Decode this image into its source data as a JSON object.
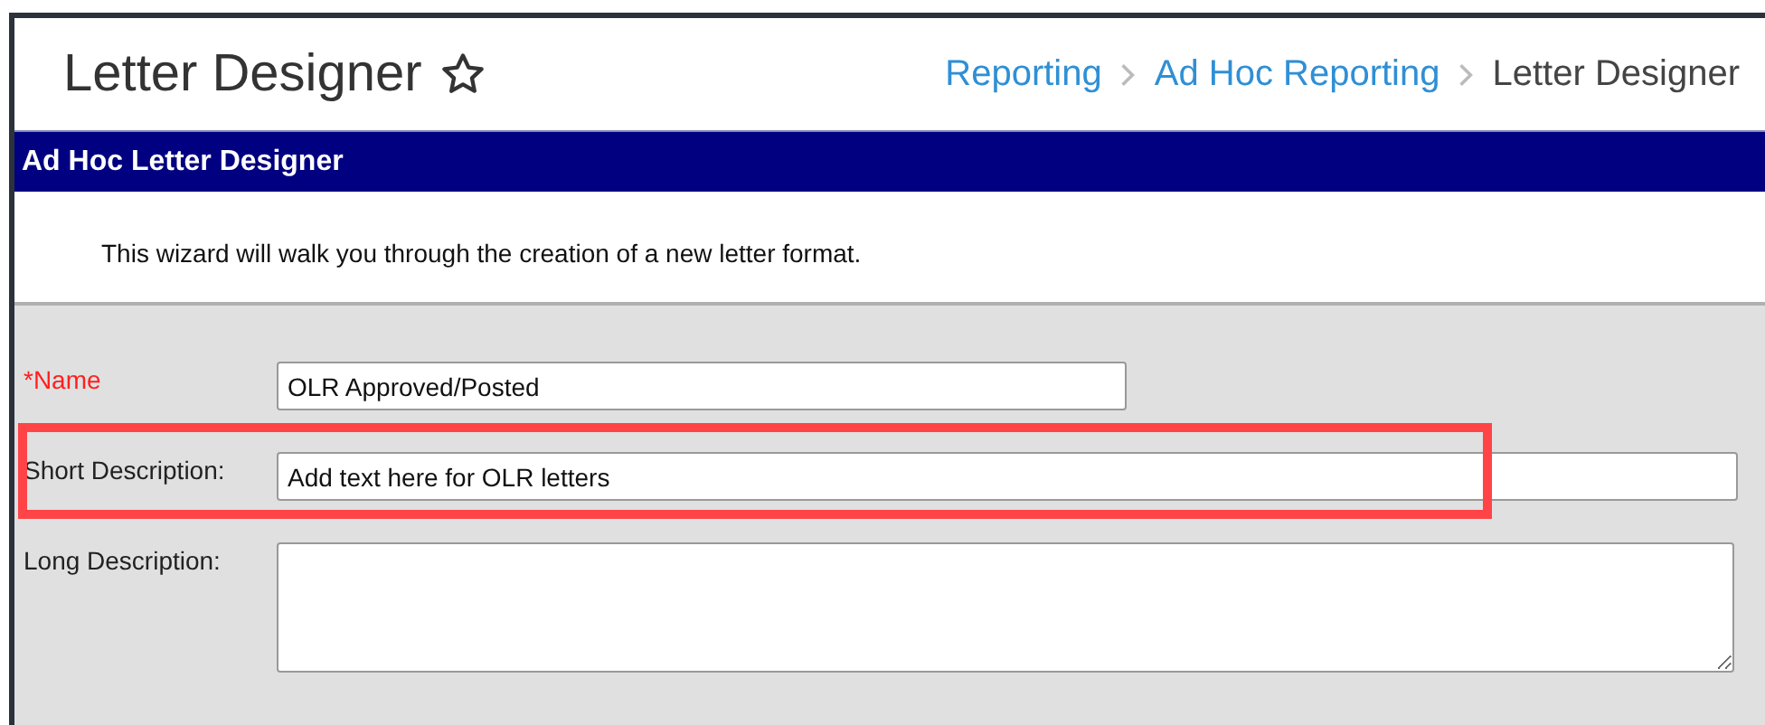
{
  "header": {
    "title": "Letter Designer",
    "favorite": false,
    "breadcrumbs": [
      {
        "label": "Reporting",
        "link": true
      },
      {
        "label": "Ad Hoc Reporting",
        "link": true
      },
      {
        "label": "Letter Designer",
        "link": false
      }
    ]
  },
  "panel": {
    "title": "Ad Hoc Letter Designer",
    "intro": "This wizard will walk you through the creation of a new letter format."
  },
  "fields": [
    {
      "kind": "short-text",
      "label": "*Name",
      "required": true,
      "value": "OLR Approved/Posted",
      "highlighted": false
    },
    {
      "kind": "text",
      "label": "Short Description:",
      "required": false,
      "value": "Add text here for OLR letters",
      "highlighted": true
    },
    {
      "kind": "textarea",
      "label": "Long Description:",
      "required": false,
      "highlighted": false
    }
  ]
}
